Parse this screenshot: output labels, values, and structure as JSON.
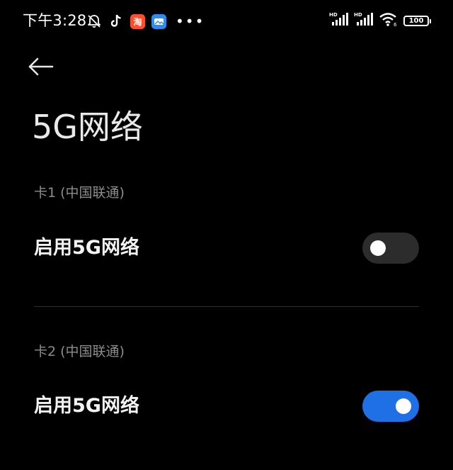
{
  "status_bar": {
    "time": "下午3:28",
    "tiktok_icon": "tiktok-icon",
    "taobao_label": "淘",
    "battery_level": "100",
    "colors": {
      "taobao": "#ff4d2e",
      "blue_app": "#2d8cf0"
    }
  },
  "header": {
    "back_icon": "back-arrow-icon",
    "title": "5G网络"
  },
  "sim1": {
    "label": "卡1 (中国联通)",
    "toggle_label": "启用5G网络",
    "enabled": false
  },
  "sim2": {
    "label": "卡2 (中国联通)",
    "toggle_label": "启用5G网络",
    "enabled": true
  },
  "colors": {
    "background": "#000000",
    "toggle_on": "#1f6fe5",
    "toggle_off": "#2c2c2c",
    "secondary_text": "#8c8c8c"
  }
}
